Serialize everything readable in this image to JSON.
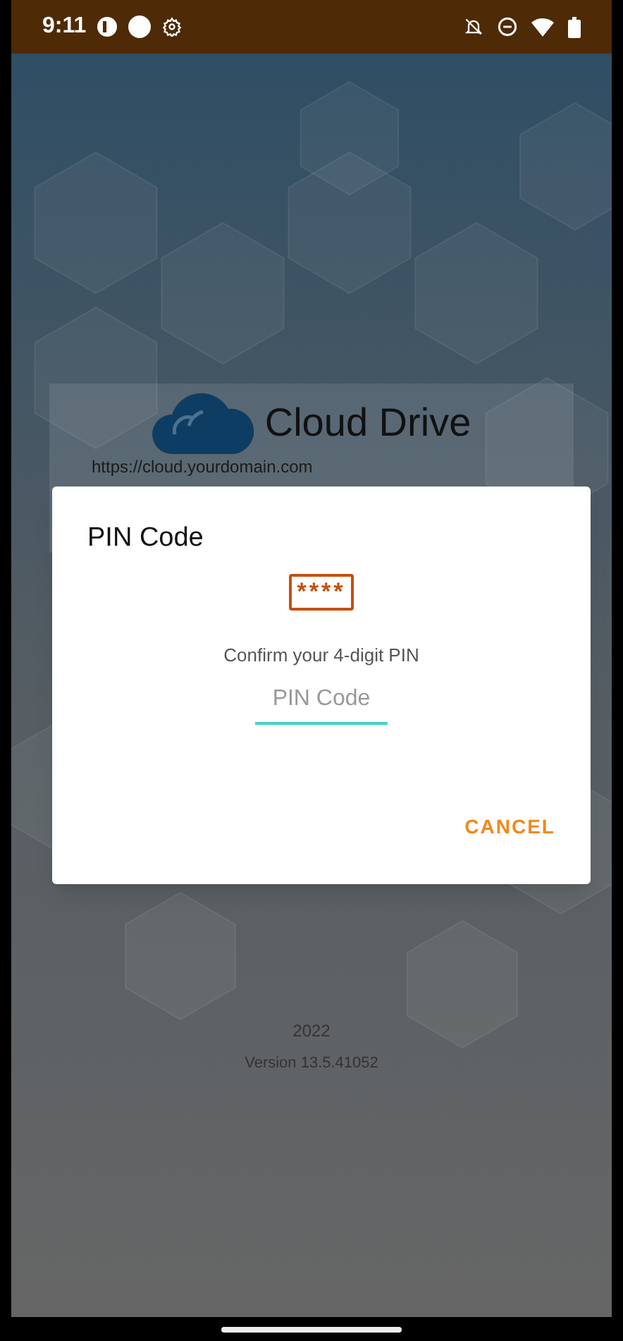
{
  "status_bar": {
    "time": "9:11"
  },
  "login": {
    "app_name": "Cloud Drive",
    "server_url": "https://cloud.yourdomain.com"
  },
  "dialog": {
    "title": "PIN Code",
    "pin_display": "****",
    "prompt": "Confirm your 4-digit PIN",
    "field": {
      "placeholder": "PIN Code"
    },
    "buttons": [
      "CANCEL"
    ]
  },
  "footer": {
    "year": "2022",
    "version": "Version 13.5.41052"
  }
}
